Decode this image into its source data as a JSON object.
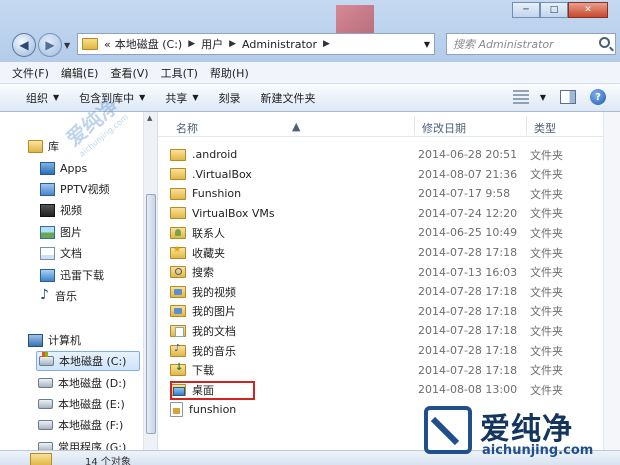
{
  "address": {
    "prefix": "«",
    "segments": [
      "本地磁盘 (C:)",
      "用户",
      "Administrator"
    ]
  },
  "search": {
    "placeholder": "搜索 Administrator"
  },
  "menu": [
    "文件(F)",
    "编辑(E)",
    "查看(V)",
    "工具(T)",
    "帮助(H)"
  ],
  "toolbar": {
    "organize": "组织",
    "include_library": "包含到库中",
    "share": "共享",
    "burn": "刻录",
    "new_folder": "新建文件夹"
  },
  "nav": {
    "libraries": "库",
    "library_items": [
      "Apps",
      "PPTV视频",
      "视频",
      "图片",
      "文档",
      "迅雷下载",
      "音乐"
    ],
    "computer": "计算机",
    "drives": [
      "本地磁盘 (C:)",
      "本地磁盘 (D:)",
      "本地磁盘 (E:)",
      "本地磁盘 (F:)",
      "常用程序 (G:)"
    ],
    "selected_drive_index": 0
  },
  "columns": {
    "name": "名称",
    "date": "修改日期",
    "type": "类型"
  },
  "files": [
    {
      "name": ".android",
      "date": "2014-06-28 20:51",
      "type": "文件夹",
      "icon": "folder-icon"
    },
    {
      "name": ".VirtualBox",
      "date": "2014-08-07 21:36",
      "type": "文件夹",
      "icon": "folder-icon"
    },
    {
      "name": "Funshion",
      "date": "2014-07-17 9:58",
      "type": "文件夹",
      "icon": "folder-icon"
    },
    {
      "name": "VirtualBox VMs",
      "date": "2014-07-24 12:20",
      "type": "文件夹",
      "icon": "folder-icon"
    },
    {
      "name": "联系人",
      "date": "2014-06-25 10:49",
      "type": "文件夹",
      "icon": "contacts-folder-icon"
    },
    {
      "name": "收藏夹",
      "date": "2014-07-28 17:18",
      "type": "文件夹",
      "icon": "favorites-folder-icon"
    },
    {
      "name": "搜索",
      "date": "2014-07-13 16:03",
      "type": "文件夹",
      "icon": "searches-folder-icon"
    },
    {
      "name": "我的视频",
      "date": "2014-07-28 17:18",
      "type": "文件夹",
      "icon": "videos-folder-icon"
    },
    {
      "name": "我的图片",
      "date": "2014-07-28 17:18",
      "type": "文件夹",
      "icon": "pictures-folder-icon"
    },
    {
      "name": "我的文档",
      "date": "2014-07-28 17:18",
      "type": "文件夹",
      "icon": "documents-folder-icon"
    },
    {
      "name": "我的音乐",
      "date": "2014-07-28 17:18",
      "type": "文件夹",
      "icon": "music-folder-icon"
    },
    {
      "name": "下载",
      "date": "2014-07-28 17:18",
      "type": "文件夹",
      "icon": "downloads-folder-icon"
    },
    {
      "name": "桌面",
      "date": "2014-08-08 13:00",
      "type": "文件夹",
      "icon": "desktop-folder-icon",
      "highlighted": true
    },
    {
      "name": "funshion",
      "date": "",
      "type": "",
      "icon": "file-icon"
    }
  ],
  "status": {
    "text": "14 个对象"
  },
  "watermark": {
    "title": "爱纯净",
    "url": "aichunjing.com"
  },
  "colors": {
    "highlight_border": "#d3251d",
    "window_frame": "#c5d9f1"
  }
}
